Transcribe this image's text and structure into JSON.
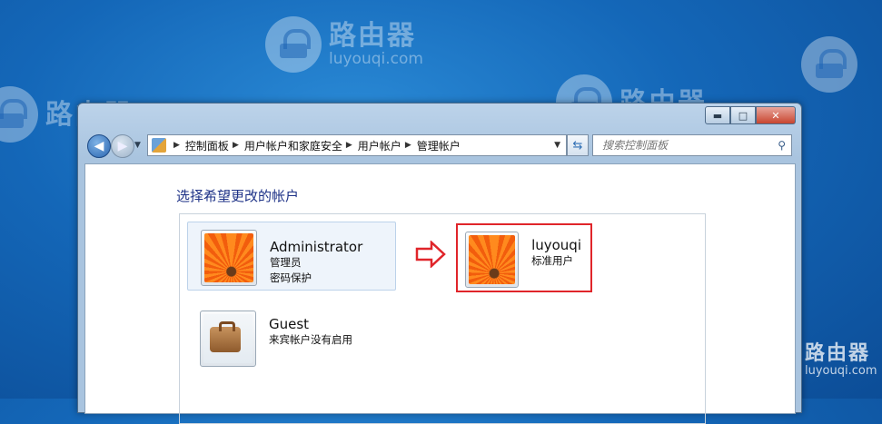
{
  "watermark": {
    "brand_cn": "路由器",
    "brand_en": "luyouqi.com"
  },
  "window": {
    "controls": {
      "minimize": "▬",
      "maximize": "□",
      "close": "✕"
    },
    "nav": {
      "back_icon": "arrow-left-icon",
      "forward_icon": "arrow-right-icon"
    },
    "address": {
      "breadcrumbs": [
        "控制面板",
        "用户帐户和家庭安全",
        "用户帐户",
        "管理帐户"
      ]
    },
    "search": {
      "placeholder": "搜索控制面板"
    }
  },
  "main": {
    "heading": "选择希望更改的帐户",
    "accounts": [
      {
        "name": "Administrator",
        "lines": [
          "管理员",
          "密码保护"
        ],
        "picture": "orange-flower-icon"
      },
      {
        "name": "luyouqi",
        "lines": [
          "标准用户"
        ],
        "picture": "orange-flower-icon"
      },
      {
        "name": "Guest",
        "lines": [
          "来宾帐户没有启用"
        ],
        "picture": "suitcase-icon"
      }
    ],
    "annotation": {
      "arrow_color": "#e0252a",
      "highlight_color": "#e0252a"
    }
  }
}
